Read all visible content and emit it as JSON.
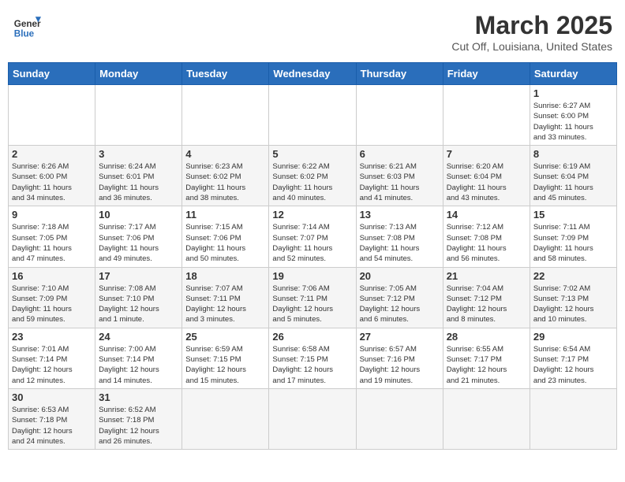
{
  "header": {
    "logo_general": "General",
    "logo_blue": "Blue",
    "month_title": "March 2025",
    "location": "Cut Off, Louisiana, United States"
  },
  "weekdays": [
    "Sunday",
    "Monday",
    "Tuesday",
    "Wednesday",
    "Thursday",
    "Friday",
    "Saturday"
  ],
  "weeks": [
    [
      {
        "day": "",
        "info": ""
      },
      {
        "day": "",
        "info": ""
      },
      {
        "day": "",
        "info": ""
      },
      {
        "day": "",
        "info": ""
      },
      {
        "day": "",
        "info": ""
      },
      {
        "day": "",
        "info": ""
      },
      {
        "day": "1",
        "info": "Sunrise: 6:27 AM\nSunset: 6:00 PM\nDaylight: 11 hours\nand 33 minutes."
      }
    ],
    [
      {
        "day": "2",
        "info": "Sunrise: 6:26 AM\nSunset: 6:00 PM\nDaylight: 11 hours\nand 34 minutes."
      },
      {
        "day": "3",
        "info": "Sunrise: 6:24 AM\nSunset: 6:01 PM\nDaylight: 11 hours\nand 36 minutes."
      },
      {
        "day": "4",
        "info": "Sunrise: 6:23 AM\nSunset: 6:02 PM\nDaylight: 11 hours\nand 38 minutes."
      },
      {
        "day": "5",
        "info": "Sunrise: 6:22 AM\nSunset: 6:02 PM\nDaylight: 11 hours\nand 40 minutes."
      },
      {
        "day": "6",
        "info": "Sunrise: 6:21 AM\nSunset: 6:03 PM\nDaylight: 11 hours\nand 41 minutes."
      },
      {
        "day": "7",
        "info": "Sunrise: 6:20 AM\nSunset: 6:04 PM\nDaylight: 11 hours\nand 43 minutes."
      },
      {
        "day": "8",
        "info": "Sunrise: 6:19 AM\nSunset: 6:04 PM\nDaylight: 11 hours\nand 45 minutes."
      }
    ],
    [
      {
        "day": "9",
        "info": "Sunrise: 7:18 AM\nSunset: 7:05 PM\nDaylight: 11 hours\nand 47 minutes."
      },
      {
        "day": "10",
        "info": "Sunrise: 7:17 AM\nSunset: 7:06 PM\nDaylight: 11 hours\nand 49 minutes."
      },
      {
        "day": "11",
        "info": "Sunrise: 7:15 AM\nSunset: 7:06 PM\nDaylight: 11 hours\nand 50 minutes."
      },
      {
        "day": "12",
        "info": "Sunrise: 7:14 AM\nSunset: 7:07 PM\nDaylight: 11 hours\nand 52 minutes."
      },
      {
        "day": "13",
        "info": "Sunrise: 7:13 AM\nSunset: 7:08 PM\nDaylight: 11 hours\nand 54 minutes."
      },
      {
        "day": "14",
        "info": "Sunrise: 7:12 AM\nSunset: 7:08 PM\nDaylight: 11 hours\nand 56 minutes."
      },
      {
        "day": "15",
        "info": "Sunrise: 7:11 AM\nSunset: 7:09 PM\nDaylight: 11 hours\nand 58 minutes."
      }
    ],
    [
      {
        "day": "16",
        "info": "Sunrise: 7:10 AM\nSunset: 7:09 PM\nDaylight: 11 hours\nand 59 minutes."
      },
      {
        "day": "17",
        "info": "Sunrise: 7:08 AM\nSunset: 7:10 PM\nDaylight: 12 hours\nand 1 minute."
      },
      {
        "day": "18",
        "info": "Sunrise: 7:07 AM\nSunset: 7:11 PM\nDaylight: 12 hours\nand 3 minutes."
      },
      {
        "day": "19",
        "info": "Sunrise: 7:06 AM\nSunset: 7:11 PM\nDaylight: 12 hours\nand 5 minutes."
      },
      {
        "day": "20",
        "info": "Sunrise: 7:05 AM\nSunset: 7:12 PM\nDaylight: 12 hours\nand 6 minutes."
      },
      {
        "day": "21",
        "info": "Sunrise: 7:04 AM\nSunset: 7:12 PM\nDaylight: 12 hours\nand 8 minutes."
      },
      {
        "day": "22",
        "info": "Sunrise: 7:02 AM\nSunset: 7:13 PM\nDaylight: 12 hours\nand 10 minutes."
      }
    ],
    [
      {
        "day": "23",
        "info": "Sunrise: 7:01 AM\nSunset: 7:14 PM\nDaylight: 12 hours\nand 12 minutes."
      },
      {
        "day": "24",
        "info": "Sunrise: 7:00 AM\nSunset: 7:14 PM\nDaylight: 12 hours\nand 14 minutes."
      },
      {
        "day": "25",
        "info": "Sunrise: 6:59 AM\nSunset: 7:15 PM\nDaylight: 12 hours\nand 15 minutes."
      },
      {
        "day": "26",
        "info": "Sunrise: 6:58 AM\nSunset: 7:15 PM\nDaylight: 12 hours\nand 17 minutes."
      },
      {
        "day": "27",
        "info": "Sunrise: 6:57 AM\nSunset: 7:16 PM\nDaylight: 12 hours\nand 19 minutes."
      },
      {
        "day": "28",
        "info": "Sunrise: 6:55 AM\nSunset: 7:17 PM\nDaylight: 12 hours\nand 21 minutes."
      },
      {
        "day": "29",
        "info": "Sunrise: 6:54 AM\nSunset: 7:17 PM\nDaylight: 12 hours\nand 23 minutes."
      }
    ],
    [
      {
        "day": "30",
        "info": "Sunrise: 6:53 AM\nSunset: 7:18 PM\nDaylight: 12 hours\nand 24 minutes."
      },
      {
        "day": "31",
        "info": "Sunrise: 6:52 AM\nSunset: 7:18 PM\nDaylight: 12 hours\nand 26 minutes."
      },
      {
        "day": "",
        "info": ""
      },
      {
        "day": "",
        "info": ""
      },
      {
        "day": "",
        "info": ""
      },
      {
        "day": "",
        "info": ""
      },
      {
        "day": "",
        "info": ""
      }
    ]
  ]
}
